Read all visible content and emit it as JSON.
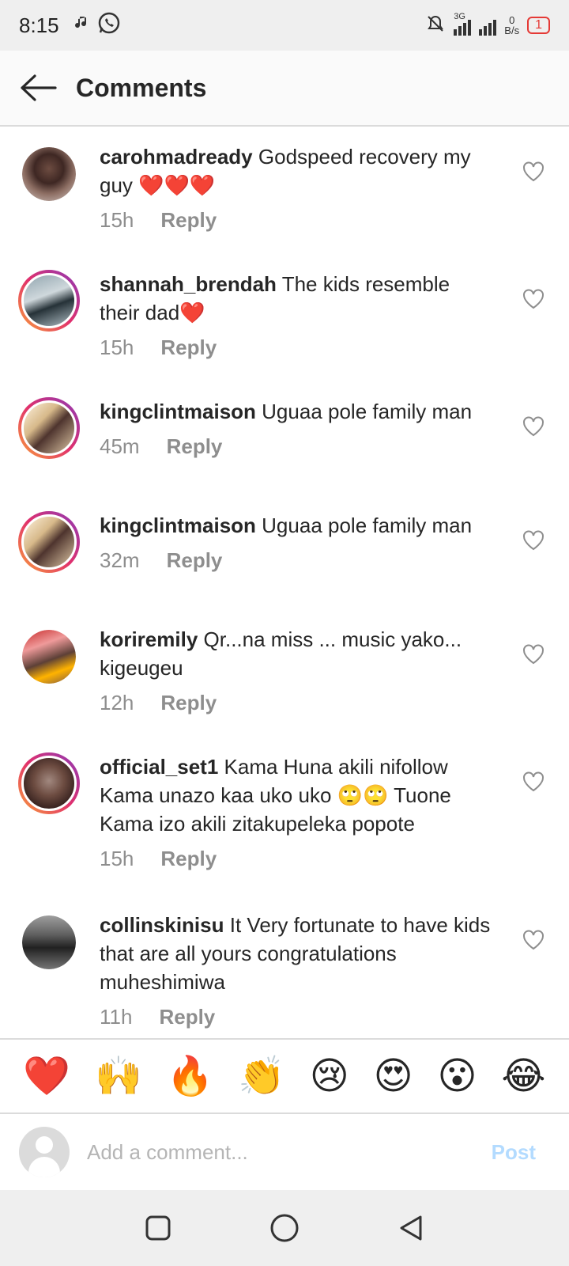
{
  "status_bar": {
    "time": "8:15",
    "network": "3G",
    "speed_value": "0",
    "speed_unit": "B/s",
    "battery": "1",
    "icons": [
      "music-note-icon",
      "whatsapp-icon",
      "bell-off-icon",
      "signal-icon",
      "signal-icon",
      "battery-icon"
    ]
  },
  "header": {
    "title": "Comments",
    "back_icon": "back-arrow-icon"
  },
  "comments": [
    {
      "user": "carohmadready",
      "text": "Godspeed recovery my guy ❤️❤️❤️",
      "time": "15h",
      "reply": "Reply"
    },
    {
      "user": "shannah_brendah",
      "text": "The kids resemble their dad❤️",
      "time": "15h",
      "reply": "Reply"
    },
    {
      "user": "kingclintmaison",
      "text": "Uguaa pole family man",
      "time": "45m",
      "reply": "Reply"
    },
    {
      "user": "kingclintmaison",
      "text": "Uguaa pole family man",
      "time": "32m",
      "reply": "Reply"
    },
    {
      "user": "koriremily",
      "text": "Qr...na miss ... music yako... kigeugeu",
      "time": "12h",
      "reply": "Reply"
    },
    {
      "user": "official_set1",
      "text": "Kama Huna akili nifollow Kama unazo kaa uko uko 🙄🙄 Tuone Kama izo akili zitakupeleka popote",
      "time": "15h",
      "reply": "Reply"
    },
    {
      "user": "collinskinisu",
      "text": "It Very fortunate  to have kids that are all yours congratulations muheshimiwa",
      "time": "11h",
      "reply": "Reply"
    }
  ],
  "reactions": [
    "❤️",
    "🙌",
    "🔥",
    "👏",
    "😢",
    "😍",
    "😮",
    "😂"
  ],
  "input": {
    "placeholder": "Add a comment...",
    "value": "",
    "post_label": "Post"
  },
  "colors": {
    "heart_outline": "#8e8e8e",
    "post_disabled": "#b3dbff",
    "muted_text": "#8e8e8e"
  }
}
